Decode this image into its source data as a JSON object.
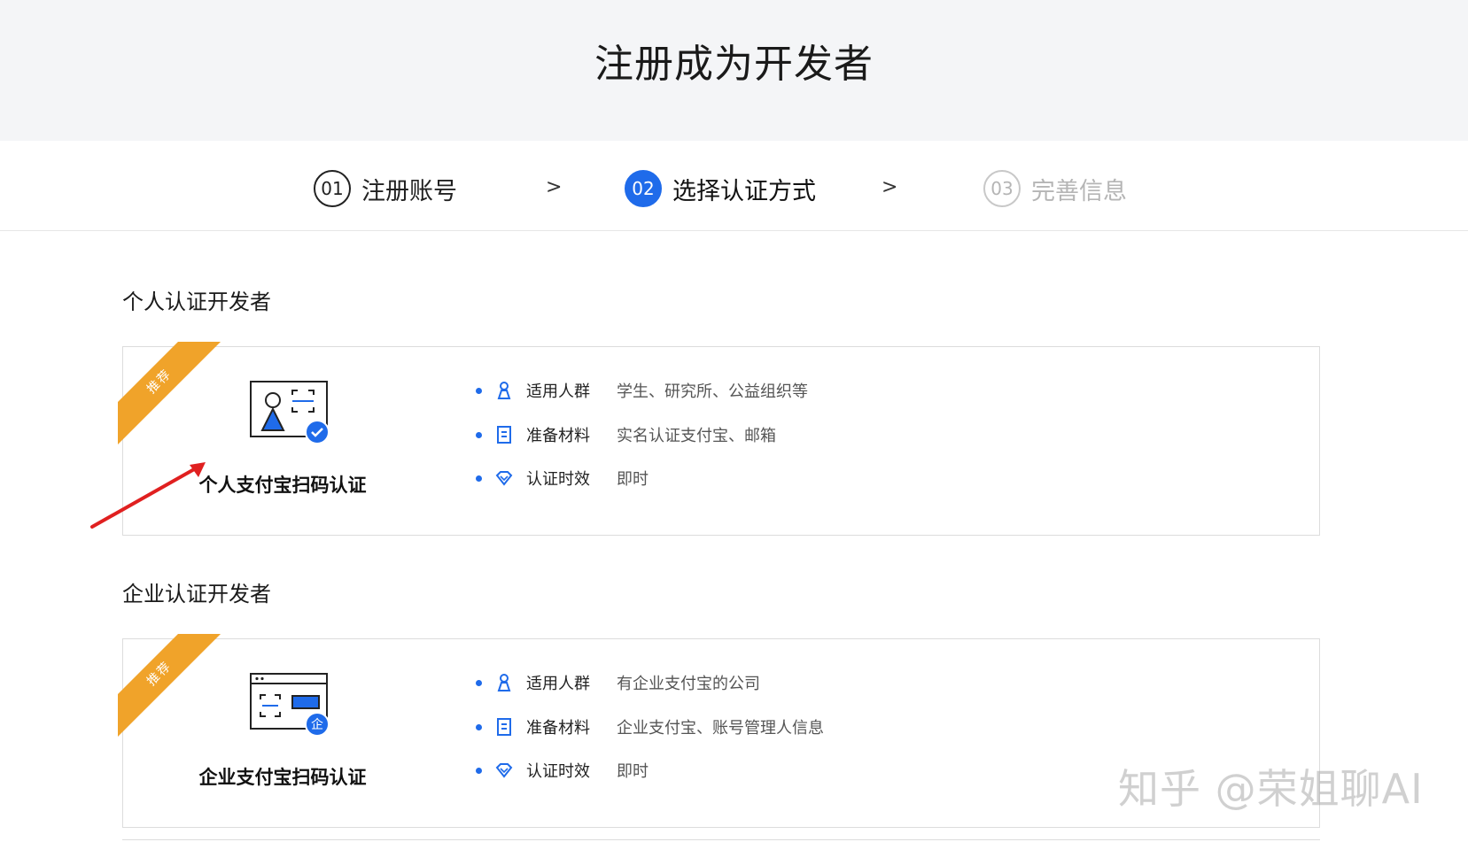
{
  "page": {
    "title": "注册成为开发者"
  },
  "steps": [
    {
      "num": "01",
      "label": "注册账号",
      "state": "done"
    },
    {
      "num": "02",
      "label": "选择认证方式",
      "state": "active"
    },
    {
      "num": "03",
      "label": "完善信息",
      "state": "todo"
    }
  ],
  "step_separator": ">",
  "sections": [
    {
      "title": "个人认证开发者",
      "card": {
        "ribbon": "推荐",
        "name": "个人支付宝扫码认证",
        "features": [
          {
            "icon": "person-icon",
            "key": "适用人群",
            "value": "学生、研究所、公益组织等"
          },
          {
            "icon": "document-icon",
            "key": "准备材料",
            "value": "实名认证支付宝、邮箱"
          },
          {
            "icon": "diamond-icon",
            "key": "认证时效",
            "value": "即时"
          }
        ]
      }
    },
    {
      "title": "企业认证开发者",
      "card": {
        "ribbon": "推荐",
        "name": "企业支付宝扫码认证",
        "badge": "企",
        "features": [
          {
            "icon": "person-icon",
            "key": "适用人群",
            "value": "有企业支付宝的公司"
          },
          {
            "icon": "document-icon",
            "key": "准备材料",
            "value": "企业支付宝、账号管理人信息"
          },
          {
            "icon": "diamond-icon",
            "key": "认证时效",
            "value": "即时"
          }
        ]
      }
    }
  ],
  "watermark": "知乎 @荣姐聊AI",
  "colors": {
    "accent": "#1f6bea",
    "ribbon": "#f0a32a",
    "annotation": "#e02020"
  }
}
